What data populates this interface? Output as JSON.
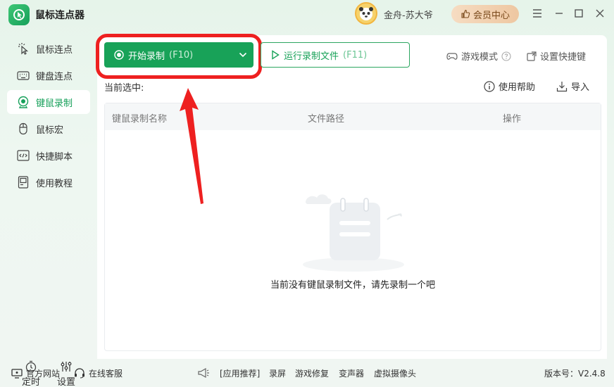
{
  "app": {
    "title": "鼠标连点器",
    "user_name": "金舟-苏大爷",
    "vip_label": "会员中心"
  },
  "sidebar": {
    "items": [
      {
        "label": "鼠标连点",
        "icon": "cursor-click-icon"
      },
      {
        "label": "键盘连点",
        "icon": "keyboard-icon"
      },
      {
        "label": "键鼠录制",
        "icon": "record-icon",
        "active": true
      },
      {
        "label": "鼠标宏",
        "icon": "mouse-icon"
      },
      {
        "label": "快捷脚本",
        "icon": "code-icon"
      },
      {
        "label": "使用教程",
        "icon": "tutorial-icon"
      }
    ],
    "bottom": [
      {
        "label": "定时",
        "icon": "timer-icon"
      },
      {
        "label": "设置",
        "icon": "settings-sliders-icon"
      }
    ]
  },
  "toolbar": {
    "record_label": "开始录制",
    "record_hotkey": "(F10)",
    "run_label": "运行录制文件",
    "run_hotkey": "(F11)",
    "game_mode": "游戏模式",
    "shortcut_settings": "设置快捷键"
  },
  "main": {
    "current_selection": "当前选中:",
    "help": "使用帮助",
    "import": "导入",
    "columns": [
      "键鼠录制名称",
      "文件路径",
      "操作"
    ],
    "empty_message": "当前没有键鼠录制文件，请先录制一个吧"
  },
  "footer": {
    "website": "官方网站",
    "support": "在线客服",
    "recommend": "[应用推荐]",
    "apps": [
      "录屏",
      "游戏修复",
      "变声器",
      "虚拟摄像头"
    ],
    "version": "版本号：V2.4.8"
  },
  "colors": {
    "accent": "#18a258",
    "highlight": "#ee2020",
    "vip": "#eec7a1"
  }
}
